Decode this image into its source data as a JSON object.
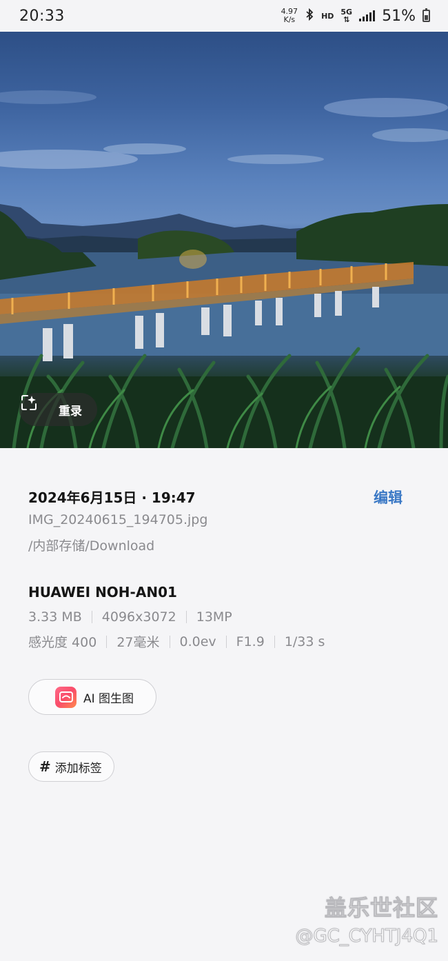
{
  "status_bar": {
    "time": "20:33",
    "speed_value": "4.97",
    "speed_unit": "K/s",
    "hd": "HD",
    "network": "5G",
    "battery": "51%"
  },
  "photo": {
    "record_label": "重录"
  },
  "details": {
    "datetime": "2024年6月15日 · 19:47",
    "edit_label": "编辑",
    "filename": "IMG_20240615_194705.jpg",
    "path": "/内部存储/Download",
    "device": "HUAWEI NOH-AN01",
    "size": "3.33 MB",
    "resolution": "4096x3072",
    "megapixels": "13MP",
    "iso": "感光度 400",
    "focal": "27毫米",
    "ev": "0.0ev",
    "aperture": "F1.9",
    "shutter": "1/33 s"
  },
  "actions": {
    "ai_label": "AI 图生图",
    "tag_label": "添加标签"
  },
  "watermark": {
    "line1": "盖乐世社区",
    "line2": "@GC_CYHTJ4Q1"
  },
  "colors": {
    "accent": "#3a78c5",
    "background": "#f5f5f7"
  }
}
